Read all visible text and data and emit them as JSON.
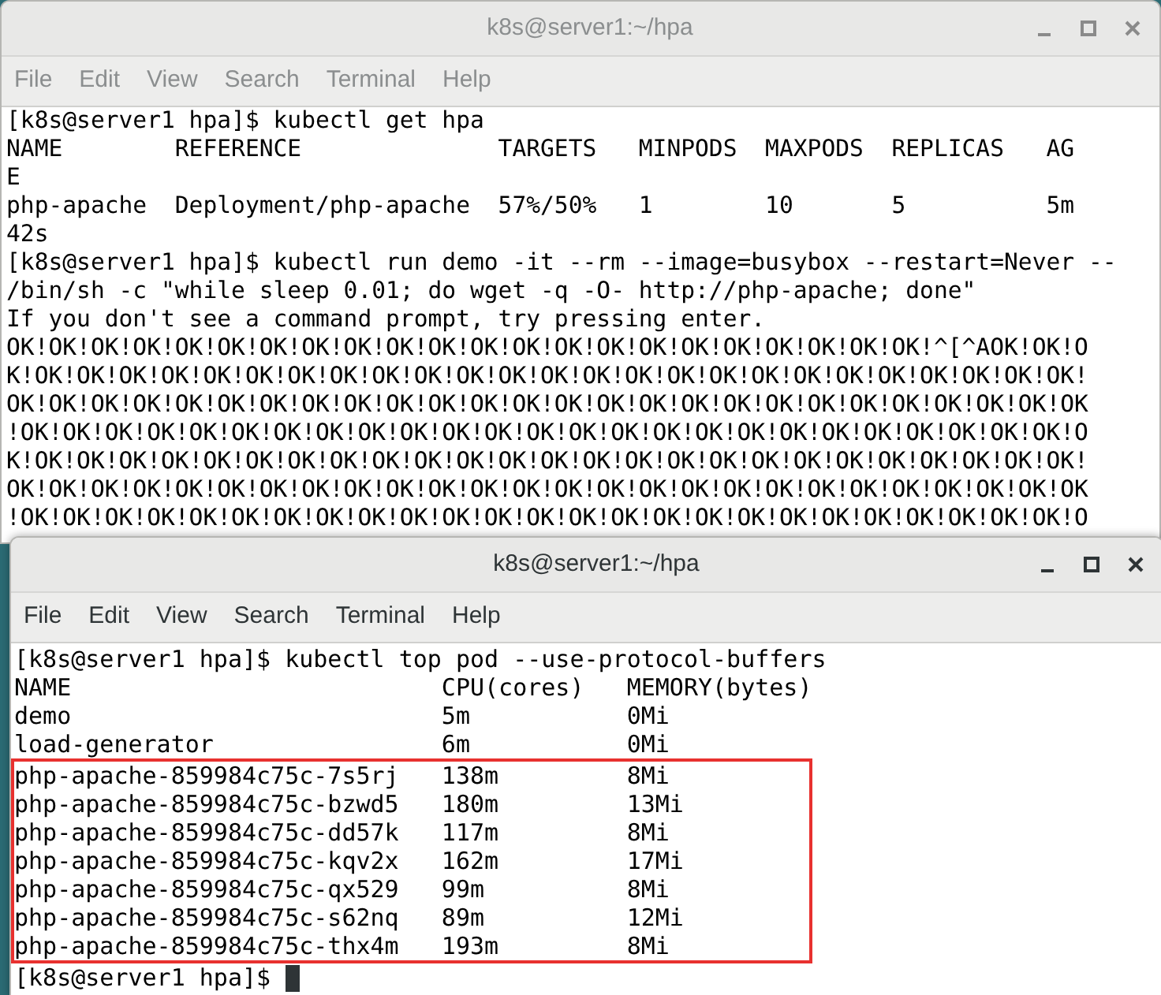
{
  "windows": [
    {
      "title": "k8s@server1:~/hpa",
      "active": false,
      "menu": [
        "File",
        "Edit",
        "View",
        "Search",
        "Terminal",
        "Help"
      ],
      "lines": [
        {
          "text": "[k8s@server1 hpa]$ kubectl get hpa",
          "highlighted": false
        },
        {
          "text": "NAME        REFERENCE              TARGETS   MINPODS  MAXPODS  REPLICAS   AG",
          "highlighted": false
        },
        {
          "text": "E",
          "highlighted": false
        },
        {
          "text": "php-apache  Deployment/php-apache  57%/50%   1        10       5          5m",
          "highlighted": false
        },
        {
          "text": "42s",
          "highlighted": false
        },
        {
          "text": "[k8s@server1 hpa]$ kubectl run demo -it --rm --image=busybox --restart=Never --",
          "highlighted": false
        },
        {
          "text": "/bin/sh -c \"while sleep 0.01; do wget -q -O- http://php-apache; done\"",
          "highlighted": false
        },
        {
          "text": "If you don't see a command prompt, try pressing enter.",
          "highlighted": false
        },
        {
          "text": "OK!OK!OK!OK!OK!OK!OK!OK!OK!OK!OK!OK!OK!OK!OK!OK!OK!OK!OK!OK!OK!OK!^[^AOK!OK!O",
          "highlighted": false
        },
        {
          "text": "K!OK!OK!OK!OK!OK!OK!OK!OK!OK!OK!OK!OK!OK!OK!OK!OK!OK!OK!OK!OK!OK!OK!OK!OK!OK!",
          "highlighted": false
        },
        {
          "text": "OK!OK!OK!OK!OK!OK!OK!OK!OK!OK!OK!OK!OK!OK!OK!OK!OK!OK!OK!OK!OK!OK!OK!OK!OK!OK",
          "highlighted": false
        },
        {
          "text": "!OK!OK!OK!OK!OK!OK!OK!OK!OK!OK!OK!OK!OK!OK!OK!OK!OK!OK!OK!OK!OK!OK!OK!OK!OK!O",
          "highlighted": false
        },
        {
          "text": "K!OK!OK!OK!OK!OK!OK!OK!OK!OK!OK!OK!OK!OK!OK!OK!OK!OK!OK!OK!OK!OK!OK!OK!OK!OK!",
          "highlighted": false
        },
        {
          "text": "OK!OK!OK!OK!OK!OK!OK!OK!OK!OK!OK!OK!OK!OK!OK!OK!OK!OK!OK!OK!OK!OK!OK!OK!OK!OK",
          "highlighted": false
        },
        {
          "text": "!OK!OK!OK!OK!OK!OK!OK!OK!OK!OK!OK!OK!OK!OK!OK!OK!OK!OK!OK!OK!OK!OK!OK!OK!OK!O",
          "highlighted": false
        }
      ]
    },
    {
      "title": "k8s@server1:~/hpa",
      "active": true,
      "menu": [
        "File",
        "Edit",
        "View",
        "Search",
        "Terminal",
        "Help"
      ],
      "lines": [
        {
          "text": "[k8s@server1 hpa]$ kubectl top pod --use-protocol-buffers",
          "highlighted": false
        },
        {
          "text": "NAME                          CPU(cores)   MEMORY(bytes)",
          "highlighted": false
        },
        {
          "text": "demo                          5m           0Mi",
          "highlighted": false
        },
        {
          "text": "load-generator                6m           0Mi",
          "highlighted": false
        },
        {
          "text": "php-apache-859984c75c-7s5rj   138m         8Mi",
          "highlighted": true
        },
        {
          "text": "php-apache-859984c75c-bzwd5   180m         13Mi",
          "highlighted": true
        },
        {
          "text": "php-apache-859984c75c-dd57k   117m         8Mi",
          "highlighted": true
        },
        {
          "text": "php-apache-859984c75c-kqv2x   162m         17Mi",
          "highlighted": true
        },
        {
          "text": "php-apache-859984c75c-qx529   99m          8Mi",
          "highlighted": true
        },
        {
          "text": "php-apache-859984c75c-s62nq   89m          12Mi",
          "highlighted": true
        },
        {
          "text": "php-apache-859984c75c-thx4m   193m         8Mi",
          "highlighted": true
        },
        {
          "text": "[k8s@server1 hpa]$",
          "highlighted": false
        }
      ],
      "cursor": true
    }
  ]
}
